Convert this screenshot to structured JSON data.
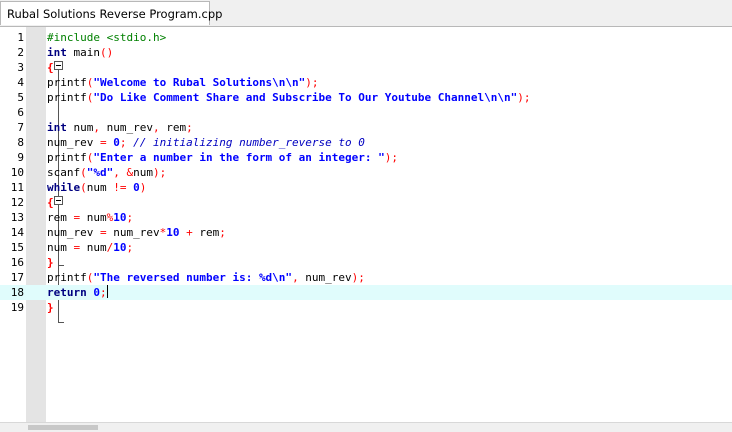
{
  "tab": {
    "title": "Rubal Solutions Reverse Program.cpp"
  },
  "editor": {
    "current_line": 18,
    "lines": [
      {
        "n": "1",
        "tokens": [
          {
            "t": "pp",
            "v": "#include <stdio.h>"
          }
        ]
      },
      {
        "n": "2",
        "tokens": [
          {
            "t": "kw",
            "v": "int"
          },
          {
            "t": "id",
            "v": " main"
          },
          {
            "t": "op",
            "v": "()"
          }
        ]
      },
      {
        "n": "3",
        "tokens": [
          {
            "t": "brace",
            "v": "{"
          }
        ]
      },
      {
        "n": "4",
        "tokens": [
          {
            "t": "id",
            "v": "printf"
          },
          {
            "t": "op",
            "v": "("
          },
          {
            "t": "st",
            "v": "\"Welcome to Rubal Solutions\\n\\n\""
          },
          {
            "t": "op",
            "v": ");"
          }
        ]
      },
      {
        "n": "5",
        "tokens": [
          {
            "t": "id",
            "v": "printf"
          },
          {
            "t": "op",
            "v": "("
          },
          {
            "t": "st",
            "v": "\"Do Like Comment Share and Subscribe To Our Youtube Channel\\n\\n\""
          },
          {
            "t": "op",
            "v": ");"
          }
        ]
      },
      {
        "n": "6",
        "tokens": []
      },
      {
        "n": "7",
        "tokens": [
          {
            "t": "kw",
            "v": "int"
          },
          {
            "t": "id",
            "v": " num"
          },
          {
            "t": "op",
            "v": ","
          },
          {
            "t": "id",
            "v": " num_rev"
          },
          {
            "t": "op",
            "v": ","
          },
          {
            "t": "id",
            "v": " rem"
          },
          {
            "t": "op",
            "v": ";"
          }
        ]
      },
      {
        "n": "8",
        "tokens": [
          {
            "t": "id",
            "v": "num_rev "
          },
          {
            "t": "op",
            "v": "="
          },
          {
            "t": "id",
            "v": " "
          },
          {
            "t": "st",
            "v": "0"
          },
          {
            "t": "op",
            "v": ";"
          },
          {
            "t": "id",
            "v": " "
          },
          {
            "t": "cm",
            "v": "// initializing number_reverse to 0"
          }
        ]
      },
      {
        "n": "9",
        "tokens": [
          {
            "t": "id",
            "v": "printf"
          },
          {
            "t": "op",
            "v": "("
          },
          {
            "t": "st",
            "v": "\"Enter a number in the form of an integer: \""
          },
          {
            "t": "op",
            "v": ");"
          }
        ]
      },
      {
        "n": "10",
        "tokens": [
          {
            "t": "id",
            "v": "scanf"
          },
          {
            "t": "op",
            "v": "("
          },
          {
            "t": "st",
            "v": "\"%d\""
          },
          {
            "t": "op",
            "v": ","
          },
          {
            "t": "id",
            "v": " "
          },
          {
            "t": "op",
            "v": "&"
          },
          {
            "t": "id",
            "v": "num"
          },
          {
            "t": "op",
            "v": ");"
          }
        ]
      },
      {
        "n": "11",
        "tokens": [
          {
            "t": "kw",
            "v": "while"
          },
          {
            "t": "op",
            "v": "("
          },
          {
            "t": "id",
            "v": "num "
          },
          {
            "t": "op",
            "v": "!="
          },
          {
            "t": "id",
            "v": " "
          },
          {
            "t": "st",
            "v": "0"
          },
          {
            "t": "op",
            "v": ")"
          }
        ]
      },
      {
        "n": "12",
        "tokens": [
          {
            "t": "brace",
            "v": "{"
          }
        ]
      },
      {
        "n": "13",
        "tokens": [
          {
            "t": "id",
            "v": "rem "
          },
          {
            "t": "op",
            "v": "="
          },
          {
            "t": "id",
            "v": " num"
          },
          {
            "t": "op",
            "v": "%"
          },
          {
            "t": "st",
            "v": "10"
          },
          {
            "t": "op",
            "v": ";"
          }
        ]
      },
      {
        "n": "14",
        "tokens": [
          {
            "t": "id",
            "v": "num_rev "
          },
          {
            "t": "op",
            "v": "="
          },
          {
            "t": "id",
            "v": " num_rev"
          },
          {
            "t": "op",
            "v": "*"
          },
          {
            "t": "st",
            "v": "10"
          },
          {
            "t": "id",
            "v": " "
          },
          {
            "t": "op",
            "v": "+"
          },
          {
            "t": "id",
            "v": " rem"
          },
          {
            "t": "op",
            "v": ";"
          }
        ]
      },
      {
        "n": "15",
        "tokens": [
          {
            "t": "id",
            "v": "num "
          },
          {
            "t": "op",
            "v": "="
          },
          {
            "t": "id",
            "v": " num"
          },
          {
            "t": "op",
            "v": "/"
          },
          {
            "t": "st",
            "v": "10"
          },
          {
            "t": "op",
            "v": ";"
          }
        ]
      },
      {
        "n": "16",
        "tokens": [
          {
            "t": "brace",
            "v": "}"
          }
        ]
      },
      {
        "n": "17",
        "tokens": [
          {
            "t": "id",
            "v": "printf"
          },
          {
            "t": "op",
            "v": "("
          },
          {
            "t": "st",
            "v": "\"The reversed number is: %d\\n\""
          },
          {
            "t": "op",
            "v": ","
          },
          {
            "t": "id",
            "v": " num_rev"
          },
          {
            "t": "op",
            "v": ");"
          }
        ]
      },
      {
        "n": "18",
        "tokens": [
          {
            "t": "kw",
            "v": "return"
          },
          {
            "t": "id",
            "v": " "
          },
          {
            "t": "st",
            "v": "0"
          },
          {
            "t": "op",
            "v": ";"
          }
        ]
      },
      {
        "n": "19",
        "tokens": [
          {
            "t": "brace",
            "v": "}"
          }
        ]
      }
    ]
  },
  "colors": {
    "keyword": "#000080",
    "string": "#0000ff",
    "operator": "#ff0000",
    "comment": "#0000c0",
    "preprocessor": "#008000",
    "current_line": "#e0fcfc"
  },
  "icons": {
    "fold_open": "minus-box-icon"
  }
}
